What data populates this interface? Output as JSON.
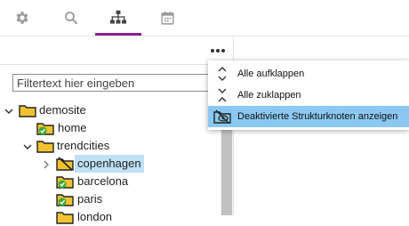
{
  "tabs": [
    {
      "name": "settings",
      "icon": "gear-icon"
    },
    {
      "name": "search",
      "icon": "search-icon"
    },
    {
      "name": "structure",
      "icon": "sitemap-icon",
      "active": true
    },
    {
      "name": "calendar",
      "icon": "calendar-icon"
    }
  ],
  "filter": {
    "placeholder": "Filtertext hier eingeben",
    "value": ""
  },
  "menu": {
    "expand_all": "Alle aufklappen",
    "collapse_all": "Alle zuklappen",
    "show_disabled": "Deaktivierte Strukturknoten anzeigen"
  },
  "tree": {
    "root": "demosite",
    "home": "home",
    "trendcities": "trendcities",
    "copenhagen": "copenhagen",
    "barcelona": "barcelona",
    "paris": "paris",
    "partial": "london"
  },
  "colors": {
    "accent": "#8a1f8f",
    "selection": "#bfe0f5",
    "menu_highlight": "#8ac8f2",
    "folder": "#f2c230",
    "check": "#39a935"
  }
}
